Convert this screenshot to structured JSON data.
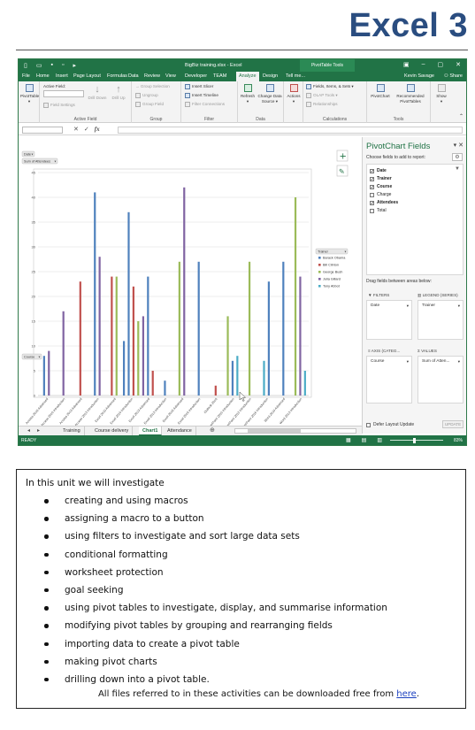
{
  "doc_title": "Excel 3",
  "excel": {
    "window_title": "BigBiz training.xlsx - Excel",
    "context_tab": "PivotTable Tools",
    "user": "Kevin Savage",
    "share": "Share",
    "ribbon_tabs": [
      {
        "label": "File",
        "active": false
      },
      {
        "label": "Home",
        "active": false
      },
      {
        "label": "Insert",
        "active": false
      },
      {
        "label": "Page Layout",
        "active": false
      },
      {
        "label": "Formulas",
        "active": false
      },
      {
        "label": "Data",
        "active": false
      },
      {
        "label": "Review",
        "active": false
      },
      {
        "label": "View",
        "active": false
      },
      {
        "label": "Developer",
        "active": false
      },
      {
        "label": "TEAM",
        "active": false
      },
      {
        "label": "Analyze",
        "active": true
      },
      {
        "label": "Design",
        "active": false
      },
      {
        "label": "Tell me...",
        "active": false
      }
    ],
    "ribbon": {
      "pivottable_label": "PivotTable",
      "active_field_label": "Active Field:",
      "field_settings": "Field Settings",
      "drill_down": "Drill Down",
      "drill_up": "Drill Up",
      "group_selection": "Group Selection",
      "ungroup": "Ungroup",
      "group_field": "Group Field",
      "insert_slicer": "Insert Slicer",
      "insert_timeline": "Insert Timeline",
      "filter_connections": "Filter Connections",
      "refresh": "Refresh",
      "change_data_source": "Change Data Source",
      "actions": "Actions",
      "fields_items_sets": "Fields, Items, & Sets",
      "olap_tools": "OLAP Tools",
      "relationships": "Relationships",
      "pivotchart": "PivotChart",
      "recommended_pivottables": "Recommended PivotTables",
      "show": "Show",
      "groups": {
        "active_field": "Active Field",
        "group": "Group",
        "filter": "Filter",
        "data": "Data",
        "calculations": "Calculations",
        "tools": "Tools"
      }
    },
    "pivot_pane": {
      "title": "PivotChart Fields",
      "subtitle": "Choose fields to add to report:",
      "fields": [
        {
          "label": "Date",
          "checked": true,
          "bold": true
        },
        {
          "label": "Trainer",
          "checked": true,
          "bold": true
        },
        {
          "label": "Course",
          "checked": true,
          "bold": true
        },
        {
          "label": "Charge",
          "checked": false,
          "bold": false
        },
        {
          "label": "Attendees",
          "checked": true,
          "bold": true
        },
        {
          "label": "Total",
          "checked": false,
          "bold": false
        }
      ],
      "drag_label": "Drag fields between areas below:",
      "areas": {
        "filters": {
          "head": "FILTERS",
          "chip": "Date"
        },
        "legend": {
          "head": "LEGEND (SERIES)",
          "chip": "Trainer"
        },
        "axis": {
          "head": "AXIS (CATEG...",
          "chip": "Course"
        },
        "values": {
          "head": "VALUES",
          "chip": "Sum of Atten..."
        }
      },
      "defer_label": "Defer Layout Update",
      "update_label": "UPDATE"
    },
    "sheet_tabs": [
      {
        "label": "Training",
        "active": false
      },
      {
        "label": "Course delivery",
        "active": false
      },
      {
        "label": "Chart1",
        "active": true
      },
      {
        "label": "Attendance",
        "active": false
      }
    ],
    "status": {
      "ready": "READY",
      "zoom": "83%"
    }
  },
  "chart_data": {
    "type": "bar",
    "filter_button": "Date",
    "values_button": "Sum of Attendees",
    "axis_button": "Course",
    "legend_title": "Trainer",
    "ylim": [
      0,
      45
    ],
    "yticks": [
      0,
      5,
      10,
      15,
      20,
      25,
      30,
      35,
      40,
      45
    ],
    "grid": true,
    "legend_position": "right",
    "series": [
      {
        "name": "Barack Obama",
        "color": "#4f81bd"
      },
      {
        "name": "Bill Clinton",
        "color": "#c0504d"
      },
      {
        "name": "George Bush",
        "color": "#9bbb59"
      },
      {
        "name": "Julia Gillard",
        "color": "#8064a2"
      },
      {
        "name": "Tony Abbot",
        "color": "#4bacc6"
      }
    ],
    "categories": [
      "Access 2010 Advanced",
      "Access 2010 Introduction",
      "Access 2013 Advanced",
      "Access 2013 Introduction",
      "Excel 2010 Advanced",
      "Excel 2010 Introduction",
      "Excel 2013 Advanced",
      "Excel 2013 Introduction",
      "Excel 2016 Advanced",
      "Excel 2016 Introduction",
      "Outlook 2010",
      "PowerPoint 2010 Introduction",
      "PowerPoint 2013 Introduction",
      "PowerPoint 2016 Introduction",
      "Word 2010 Advanced",
      "Word 2013 Introduction"
    ],
    "bars": [
      [
        {
          "s": 0,
          "v": 8
        },
        {
          "s": 3,
          "v": 9
        }
      ],
      [
        {
          "s": 3,
          "v": 17
        }
      ],
      [
        {
          "s": 1,
          "v": 23
        }
      ],
      [
        {
          "s": 0,
          "v": 41
        },
        {
          "s": 3,
          "v": 28
        }
      ],
      [
        {
          "s": 1,
          "v": 24
        },
        {
          "s": 2,
          "v": 24
        }
      ],
      [
        {
          "s": 0,
          "v": 11
        },
        {
          "s": 0,
          "v": 37
        },
        {
          "s": 1,
          "v": 22
        },
        {
          "s": 2,
          "v": 15
        }
      ],
      [
        {
          "s": 3,
          "v": 16
        },
        {
          "s": 0,
          "v": 24
        },
        {
          "s": 1,
          "v": 5
        }
      ],
      [
        {
          "s": 0,
          "v": 3
        }
      ],
      [
        {
          "s": 2,
          "v": 27
        },
        {
          "s": 3,
          "v": 42
        }
      ],
      [
        {
          "s": 0,
          "v": 27
        }
      ],
      [
        {
          "s": 1,
          "v": 2
        }
      ],
      [
        {
          "s": 2,
          "v": 16
        },
        {
          "s": 0,
          "v": 7
        },
        {
          "s": 4,
          "v": 8
        }
      ],
      [
        {
          "s": 2,
          "v": 27
        }
      ],
      [
        {
          "s": 4,
          "v": 7
        },
        {
          "s": 0,
          "v": 23
        }
      ],
      [
        {
          "s": 0,
          "v": 27
        }
      ],
      [
        {
          "s": 2,
          "v": 40
        },
        {
          "s": 3,
          "v": 24
        },
        {
          "s": 4,
          "v": 5
        }
      ]
    ]
  },
  "info": {
    "intro": "In this unit we will investigate",
    "topics": [
      "creating and using macros",
      "assigning a macro to a button",
      "using filters to investigate and sort large data sets",
      "conditional formatting",
      "worksheet protection",
      "goal seeking",
      "using pivot tables to investigate, display, and summarise information",
      "modifying pivot tables by grouping and rearranging fields",
      "importing data to create a pivot table",
      "making pivot charts",
      "drilling down into a pivot table."
    ],
    "footer_text": "All files referred to in these activities can be downloaded free from ",
    "footer_link": "here",
    "footer_end": "."
  }
}
